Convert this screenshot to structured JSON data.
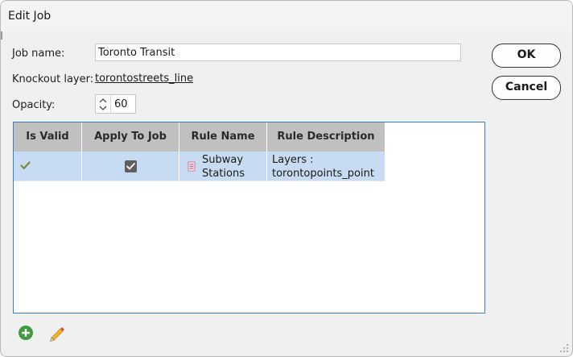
{
  "window": {
    "title": "Edit Job"
  },
  "form": {
    "job_name_label": "Job name:",
    "job_name_value": "Toronto Transit",
    "knockout_label": "Knockout layer:",
    "knockout_value": "torontostreets_line",
    "opacity_label": "Opacity:",
    "opacity_value": "60"
  },
  "buttons": {
    "ok": "OK",
    "cancel": "Cancel"
  },
  "table": {
    "headers": [
      "Is Valid",
      "Apply To Job",
      "Rule Name",
      "Rule Description"
    ],
    "rows": [
      {
        "is_valid": true,
        "apply_to_job": true,
        "rule_name_line1": "Subway",
        "rule_name_line2": "Stations",
        "rule_desc_line1": "Layers :",
        "rule_desc_line2": "torontopoints_point"
      }
    ]
  },
  "icons": {
    "valid": "checkmark-icon",
    "rule": "document-icon",
    "add": "add-icon",
    "edit": "pencil-icon",
    "resize": "resize-grip-icon"
  },
  "colors": {
    "grid_border": "#3a7fc1",
    "selected_row": "#c7dcf2",
    "header_bg": "#c0c0c0",
    "valid_check": "#7a8a3a",
    "add_green": "#3f9c3f"
  }
}
